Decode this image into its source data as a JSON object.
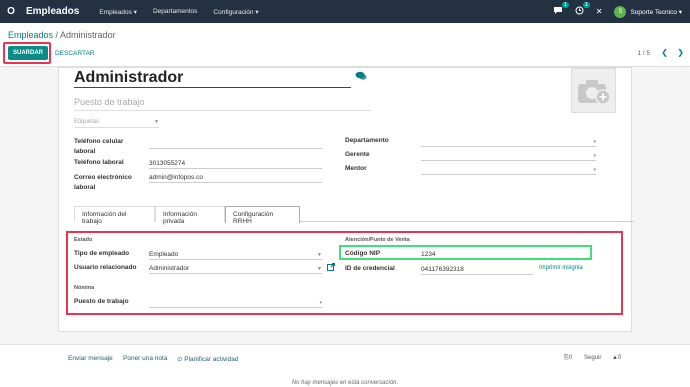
{
  "navbar": {
    "logo": "O",
    "app_name": "Empleados",
    "menu": [
      "Empleados ▾",
      "Departamentos",
      "Configuración ▾"
    ],
    "chat_badge": "1",
    "activity_badge": "1",
    "user_initial": "S",
    "user_name": "Soporte Tecnico ▾"
  },
  "breadcrumb": {
    "parent": "Empleados",
    "separator": " / ",
    "current": "Administrador"
  },
  "toolbar": {
    "save_label": "SUARDAR",
    "discard_label": "DESCARTAR",
    "pager": "1 / 5"
  },
  "employee": {
    "name": "Administrador",
    "job_placeholder": "Puesto de trabajo",
    "tags_placeholder": "Etiquetas",
    "mobile_label": "Teléfono celular laboral",
    "work_phone_label": "Teléfono laboral",
    "work_phone": "3013055274",
    "email_label": "Correo electrónico laboral",
    "email": "admin@infopos.co",
    "department_label": "Departamento",
    "manager_label": "Gerente",
    "coach_label": "Mentor"
  },
  "tabs": [
    "Información del trabajo",
    "Información privada",
    "Configuración RRHH"
  ],
  "hr": {
    "status_head": "Estado",
    "employee_type_label": "Tipo de empleado",
    "employee_type": "Empleado",
    "related_user_label": "Usuario relacionado",
    "related_user": "Administrador",
    "payroll_head": "Nómina",
    "job_label": "Puesto de trabajo",
    "attendance_head": "Atención/Punto de Venta",
    "pin_label": "Código NIP",
    "pin": "1234",
    "badge_label": "ID de credencial",
    "badge": "041176392318",
    "print_badge": "Imprimir insignia"
  },
  "chatter": {
    "send_message": "Enviar mensaje",
    "log_note": "Poner una nota",
    "schedule": "Planificar actividad",
    "attachments": "0",
    "follow": "Seguir",
    "followers": "0",
    "empty": "No hay mensajes en esta conversación."
  },
  "colors": {
    "navbar": "#243143",
    "primary": "#0b8c86",
    "highlight_red": "#e8344f",
    "highlight_green": "#3de07a"
  }
}
